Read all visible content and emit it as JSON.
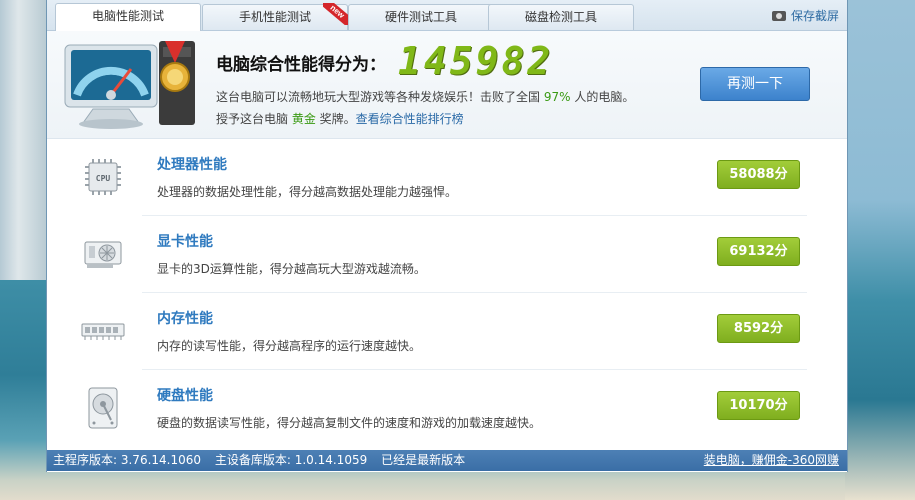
{
  "tabs": [
    {
      "label": "电脑性能测试",
      "active": true
    },
    {
      "label": "手机性能测试",
      "badge": "new"
    },
    {
      "label": "硬件测试工具"
    },
    {
      "label": "磁盘检测工具"
    }
  ],
  "save_screenshot": "保存截屏",
  "header": {
    "title": "电脑综合性能得分为：",
    "score": "145982",
    "line1_prefix": "这台电脑可以流畅地玩大型游戏等各种发烧娱乐！击败了全国 ",
    "line1_pct": "97%",
    "line1_suffix": " 人的电脑。",
    "line2_prefix": "授予这台电脑 ",
    "line2_medal": "黄金",
    "line2_mid": " 奖牌。",
    "line2_link": "查看综合性能排行榜",
    "retest_button": "再测一下"
  },
  "rows": [
    {
      "name": "处理器性能",
      "desc": "处理器的数据处理性能，得分越高数据处理能力越强悍。",
      "score": "58088分",
      "icon": "cpu-icon",
      "icon_text": "CPU"
    },
    {
      "name": "显卡性能",
      "desc": "显卡的3D运算性能，得分越高玩大型游戏越流畅。",
      "score": "69132分",
      "icon": "graphics-card-icon"
    },
    {
      "name": "内存性能",
      "desc": "内存的读写性能，得分越高程序的运行速度越快。",
      "score": "8592分",
      "icon": "memory-icon"
    },
    {
      "name": "硬盘性能",
      "desc": "硬盘的数据读写性能，得分越高复制文件的速度和游戏的加载速度越快。",
      "score": "10170分",
      "icon": "hard-disk-icon"
    }
  ],
  "status": {
    "main_version": "主程序版本: 3.76.14.1060",
    "db_version": "主设备库版本: 1.0.14.1059",
    "latest": "已经是最新版本",
    "right_link": "装电脑，赚佣金-360网赚"
  },
  "colors": {
    "accent_blue": "#2f7abf",
    "score_green": "#80b818",
    "pill_green": "#8fbd2a",
    "status_bar": "#3f72aa"
  }
}
